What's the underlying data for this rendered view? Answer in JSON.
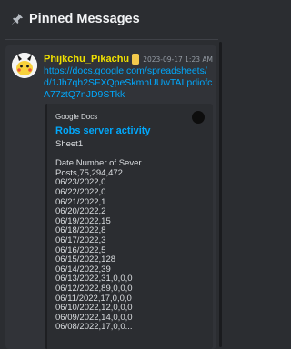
{
  "header": {
    "title": "Pinned Messages",
    "icon": "pin-icon"
  },
  "message": {
    "username": "Phijkchu_Pikachu",
    "username_color": "#f0e000",
    "timestamp": "2023-09-17 1:23 AM",
    "link_text": "https://docs.google.com/spreadsheets/d/1Jh7qh2SFXQpeSkmhUUwTALpdiofcA77ztQ7nJD9STkk",
    "embed": {
      "provider": "Google Docs",
      "title": "Robs server activity",
      "description": "Sheet1\n\nDate,Number of Sever\nPosts,75,294,472\n06/23/2022,0\n06/22/2022,0\n06/21/2022,1\n06/20/2022,2\n06/19/2022,15\n06/18/2022,8\n06/17/2022,3\n06/16/2022,5\n06/15/2022,128\n06/14/2022,39\n06/13/2022,31,0,0,0\n06/12/2022,89,0,0,0\n06/11/2022,17,0,0,0\n06/10/2022,12,0,0,0\n06/09/2022,14,0,0,0\n06/08/2022,17,0,0..."
    }
  },
  "colors": {
    "background": "#2b2d31",
    "message_bg": "#313338",
    "link": "#00a8fc",
    "text": "#dbdee1"
  }
}
